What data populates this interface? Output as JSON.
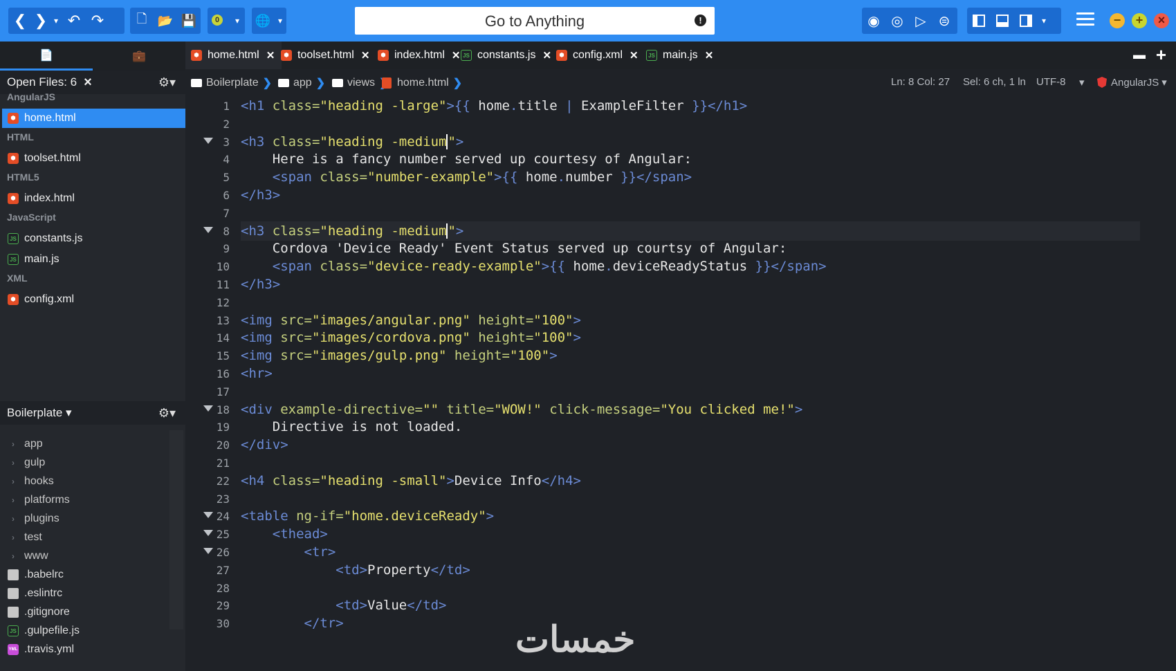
{
  "toolbar": {
    "goto_placeholder": "Go to Anything",
    "goto_alert": "!",
    "badge": "0",
    "nav_back": "❮",
    "nav_forward": "❯",
    "dropdown": "▾",
    "undo": "↶",
    "redo": "↷",
    "new_file": "🗋",
    "open_folder": "📂",
    "save": "💾",
    "globe": "🌐",
    "record": "◉",
    "stop": "◎",
    "play": "▷",
    "stop_alt": "⊜",
    "layout_left": "▣",
    "layout_bottom": "▣",
    "layout_right": "▣",
    "win_min": "−",
    "win_max": "+",
    "win_close": "×"
  },
  "sidebar": {
    "tab_files_icon": "📄",
    "tab_tools_icon": "💼",
    "open_files_label": "Open Files: 6",
    "close_glyph": "×",
    "gear": "⚙▾",
    "groups": [
      {
        "name": "AngularJS",
        "files": [
          {
            "name": "home.html",
            "type": "html",
            "active": true
          }
        ]
      },
      {
        "name": "HTML",
        "files": [
          {
            "name": "toolset.html",
            "type": "html"
          }
        ]
      },
      {
        "name": "HTML5",
        "files": [
          {
            "name": "index.html",
            "type": "html"
          }
        ]
      },
      {
        "name": "JavaScript",
        "files": [
          {
            "name": "constants.js",
            "type": "js"
          },
          {
            "name": "main.js",
            "type": "js"
          }
        ]
      },
      {
        "name": "XML",
        "files": [
          {
            "name": "config.xml",
            "type": "html"
          }
        ]
      }
    ],
    "project_label": "Boilerplate ▾",
    "tree": [
      {
        "name": "app",
        "kind": "folder"
      },
      {
        "name": "gulp",
        "kind": "folder"
      },
      {
        "name": "hooks",
        "kind": "folder"
      },
      {
        "name": "platforms",
        "kind": "folder"
      },
      {
        "name": "plugins",
        "kind": "folder"
      },
      {
        "name": "test",
        "kind": "folder"
      },
      {
        "name": "www",
        "kind": "folder"
      },
      {
        "name": ".babelrc",
        "kind": "doc"
      },
      {
        "name": ".eslintrc",
        "kind": "doc"
      },
      {
        "name": ".gitignore",
        "kind": "doc"
      },
      {
        "name": ".gulpefile.js",
        "kind": "js"
      },
      {
        "name": ".travis.yml",
        "kind": "yml"
      }
    ]
  },
  "tabs": [
    {
      "label": "home.html",
      "type": "html",
      "active": true
    },
    {
      "label": "toolset.html",
      "type": "html"
    },
    {
      "label": "index.html",
      "type": "html"
    },
    {
      "label": "constants.js",
      "type": "js"
    },
    {
      "label": "config.xml",
      "type": "html"
    },
    {
      "label": "main.js",
      "type": "js"
    }
  ],
  "breadcrumb": [
    "Boilerplate",
    "app",
    "views",
    "home.html"
  ],
  "status": {
    "position": "Ln: 8 Col: 27",
    "selection": "Sel: 6 ch, 1 ln",
    "encoding": "UTF-8",
    "language": "AngularJS"
  },
  "editor": {
    "lines": [
      {
        "n": "1",
        "html": "<span class='t'>&lt;h1</span> <span class='a'>class=</span><span class='s'>\"heading -large\"</span><span class='t'>&gt;{{</span> home<span class='t'>.</span>title <span class='t'>|</span> ExampleFilter <span class='t'>}}&lt;/h1&gt;</span>"
      },
      {
        "n": "2",
        "html": ""
      },
      {
        "n": "3",
        "fold": true,
        "html": "<span class='t'>&lt;h3</span> <span class='a'>class=</span><span class='s'>\"heading -medium<span class='cursor'></span>\"</span><span class='t'>&gt;</span>"
      },
      {
        "n": "4",
        "html": "    Here is a fancy number served up courtesy of Angular:"
      },
      {
        "n": "5",
        "html": "    <span class='t'>&lt;span</span> <span class='a'>class=</span><span class='s'>\"number-example\"</span><span class='t'>&gt;{{</span> home<span class='t'>.</span>number <span class='t'>}}&lt;/span&gt;</span>"
      },
      {
        "n": "6",
        "html": "<span class='t'>&lt;/h3&gt;</span>"
      },
      {
        "n": "7",
        "html": ""
      },
      {
        "n": "8",
        "fold": true,
        "current": true,
        "html": "<span class='t'>&lt;h3</span> <span class='a'>class=</span><span class='s'>\"heading -medium<span class='cursor'></span>\"</span><span class='t'>&gt;</span>"
      },
      {
        "n": "9",
        "html": "    Cordova 'Device Ready' Event Status served up courtsy of Angular:"
      },
      {
        "n": "10",
        "html": "    <span class='t'>&lt;span</span> <span class='a'>class=</span><span class='s'>\"device-ready-example\"</span><span class='t'>&gt;{{</span> home<span class='t'>.</span>deviceReadyStatus <span class='t'>}}&lt;/span&gt;</span>"
      },
      {
        "n": "11",
        "html": "<span class='t'>&lt;/h3&gt;</span>"
      },
      {
        "n": "12",
        "html": ""
      },
      {
        "n": "13",
        "html": "<span class='t'>&lt;img</span> <span class='a'>src=</span><span class='s'>\"images/angular.png\"</span> <span class='a'>height=</span><span class='s'>\"100\"</span><span class='t'>&gt;</span>"
      },
      {
        "n": "14",
        "html": "<span class='t'>&lt;img</span> <span class='a'>src=</span><span class='s'>\"images/cordova.png\"</span> <span class='a'>height=</span><span class='s'>\"100\"</span><span class='t'>&gt;</span>"
      },
      {
        "n": "15",
        "html": "<span class='t'>&lt;img</span> <span class='a'>src=</span><span class='s'>\"images/gulp.png\"</span> <span class='a'>height=</span><span class='s'>\"100\"</span><span class='t'>&gt;</span>"
      },
      {
        "n": "16",
        "html": "<span class='t'>&lt;hr&gt;</span>"
      },
      {
        "n": "17",
        "html": ""
      },
      {
        "n": "18",
        "fold": true,
        "html": "<span class='t'>&lt;div</span> <span class='a'>example-directive=</span><span class='s'>\"\"</span> <span class='a'>title=</span><span class='s'>\"WOW!\"</span> <span class='a'>click-message=</span><span class='s'>\"You clicked me!\"</span><span class='t'>&gt;</span>"
      },
      {
        "n": "19",
        "html": "    Directive is not loaded."
      },
      {
        "n": "20",
        "html": "<span class='t'>&lt;/div&gt;</span>"
      },
      {
        "n": "21",
        "html": ""
      },
      {
        "n": "22",
        "html": "<span class='t'>&lt;h4</span> <span class='a'>class=</span><span class='s'>\"heading -small\"</span><span class='t'>&gt;</span>Device Info<span class='t'>&lt;/h4&gt;</span>"
      },
      {
        "n": "23",
        "html": ""
      },
      {
        "n": "24",
        "fold": true,
        "html": "<span class='t'>&lt;table</span> <span class='a'>ng-if=</span><span class='s'>\"home.deviceReady\"</span><span class='t'>&gt;</span>"
      },
      {
        "n": "25",
        "fold": true,
        "html": "    <span class='t'>&lt;thead&gt;</span>"
      },
      {
        "n": "26",
        "fold": true,
        "html": "        <span class='t'>&lt;tr&gt;</span>"
      },
      {
        "n": "27",
        "html": "            <span class='t'>&lt;td&gt;</span>Property<span class='t'>&lt;/td&gt;</span>"
      },
      {
        "n": "28",
        "html": ""
      },
      {
        "n": "29",
        "html": "            <span class='t'>&lt;td&gt;</span>Value<span class='t'>&lt;/td&gt;</span>"
      },
      {
        "n": "30",
        "html": "        <span class='t'>&lt;/tr&gt;</span>"
      }
    ]
  },
  "watermark": "خمسات"
}
